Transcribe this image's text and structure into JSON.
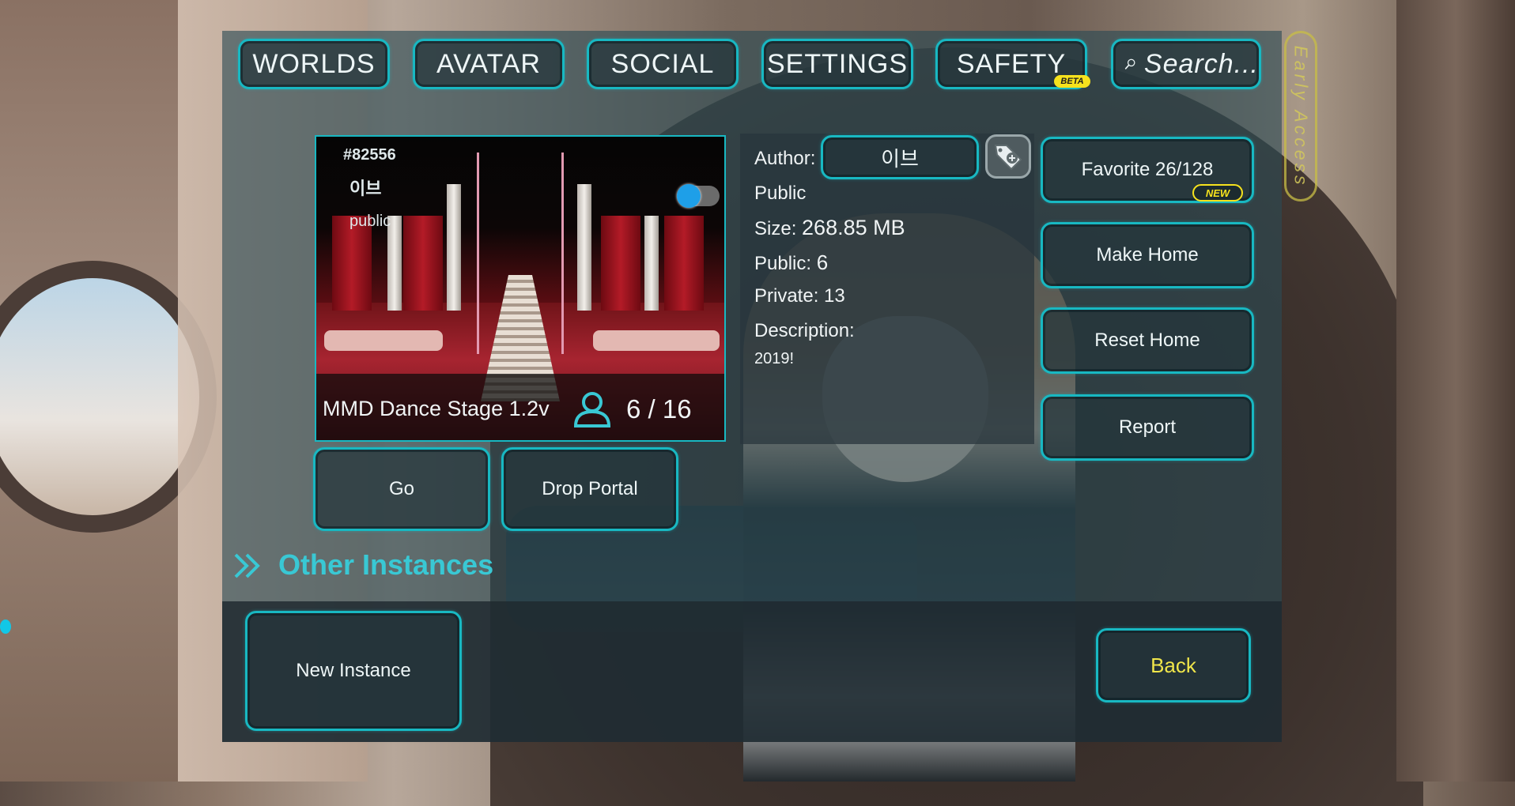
{
  "nav": {
    "tabs": [
      {
        "label": "WORLDS"
      },
      {
        "label": "AVATAR"
      },
      {
        "label": "SOCIAL"
      },
      {
        "label": "SETTINGS"
      },
      {
        "label": "SAFETY"
      }
    ],
    "beta_badge": "BETA",
    "search_placeholder": "Search...",
    "early_access": "Early Access"
  },
  "world": {
    "thumbnail": {
      "id": "#82556",
      "author": "이브",
      "access": "public"
    },
    "name": "MMD Dance Stage 1.2v",
    "player_count": "6 / 16",
    "icon": "person-icon"
  },
  "info": {
    "author_label": "Author:",
    "author_name": "이브",
    "visibility": "Public",
    "size_label": "Size:",
    "size_value": "268.85 MB",
    "public_label": "Public:",
    "public_value": "6",
    "private_label": "Private:",
    "private_value": "13",
    "description_label": "Description:",
    "description": "2019!"
  },
  "actions": {
    "favorite": "Favorite 26/128",
    "new_badge": "NEW",
    "make_home": "Make Home",
    "reset_home": "Reset Home",
    "report": "Report",
    "go": "Go",
    "drop_portal": "Drop Portal",
    "new_instance": "New Instance",
    "back": "Back"
  },
  "other_instances": {
    "title": "Other Instances"
  },
  "colors": {
    "accent": "#18b8c2",
    "title_accent": "#39c8d4",
    "highlight_yellow": "#f6e21d",
    "back_text": "#f0e64a"
  }
}
